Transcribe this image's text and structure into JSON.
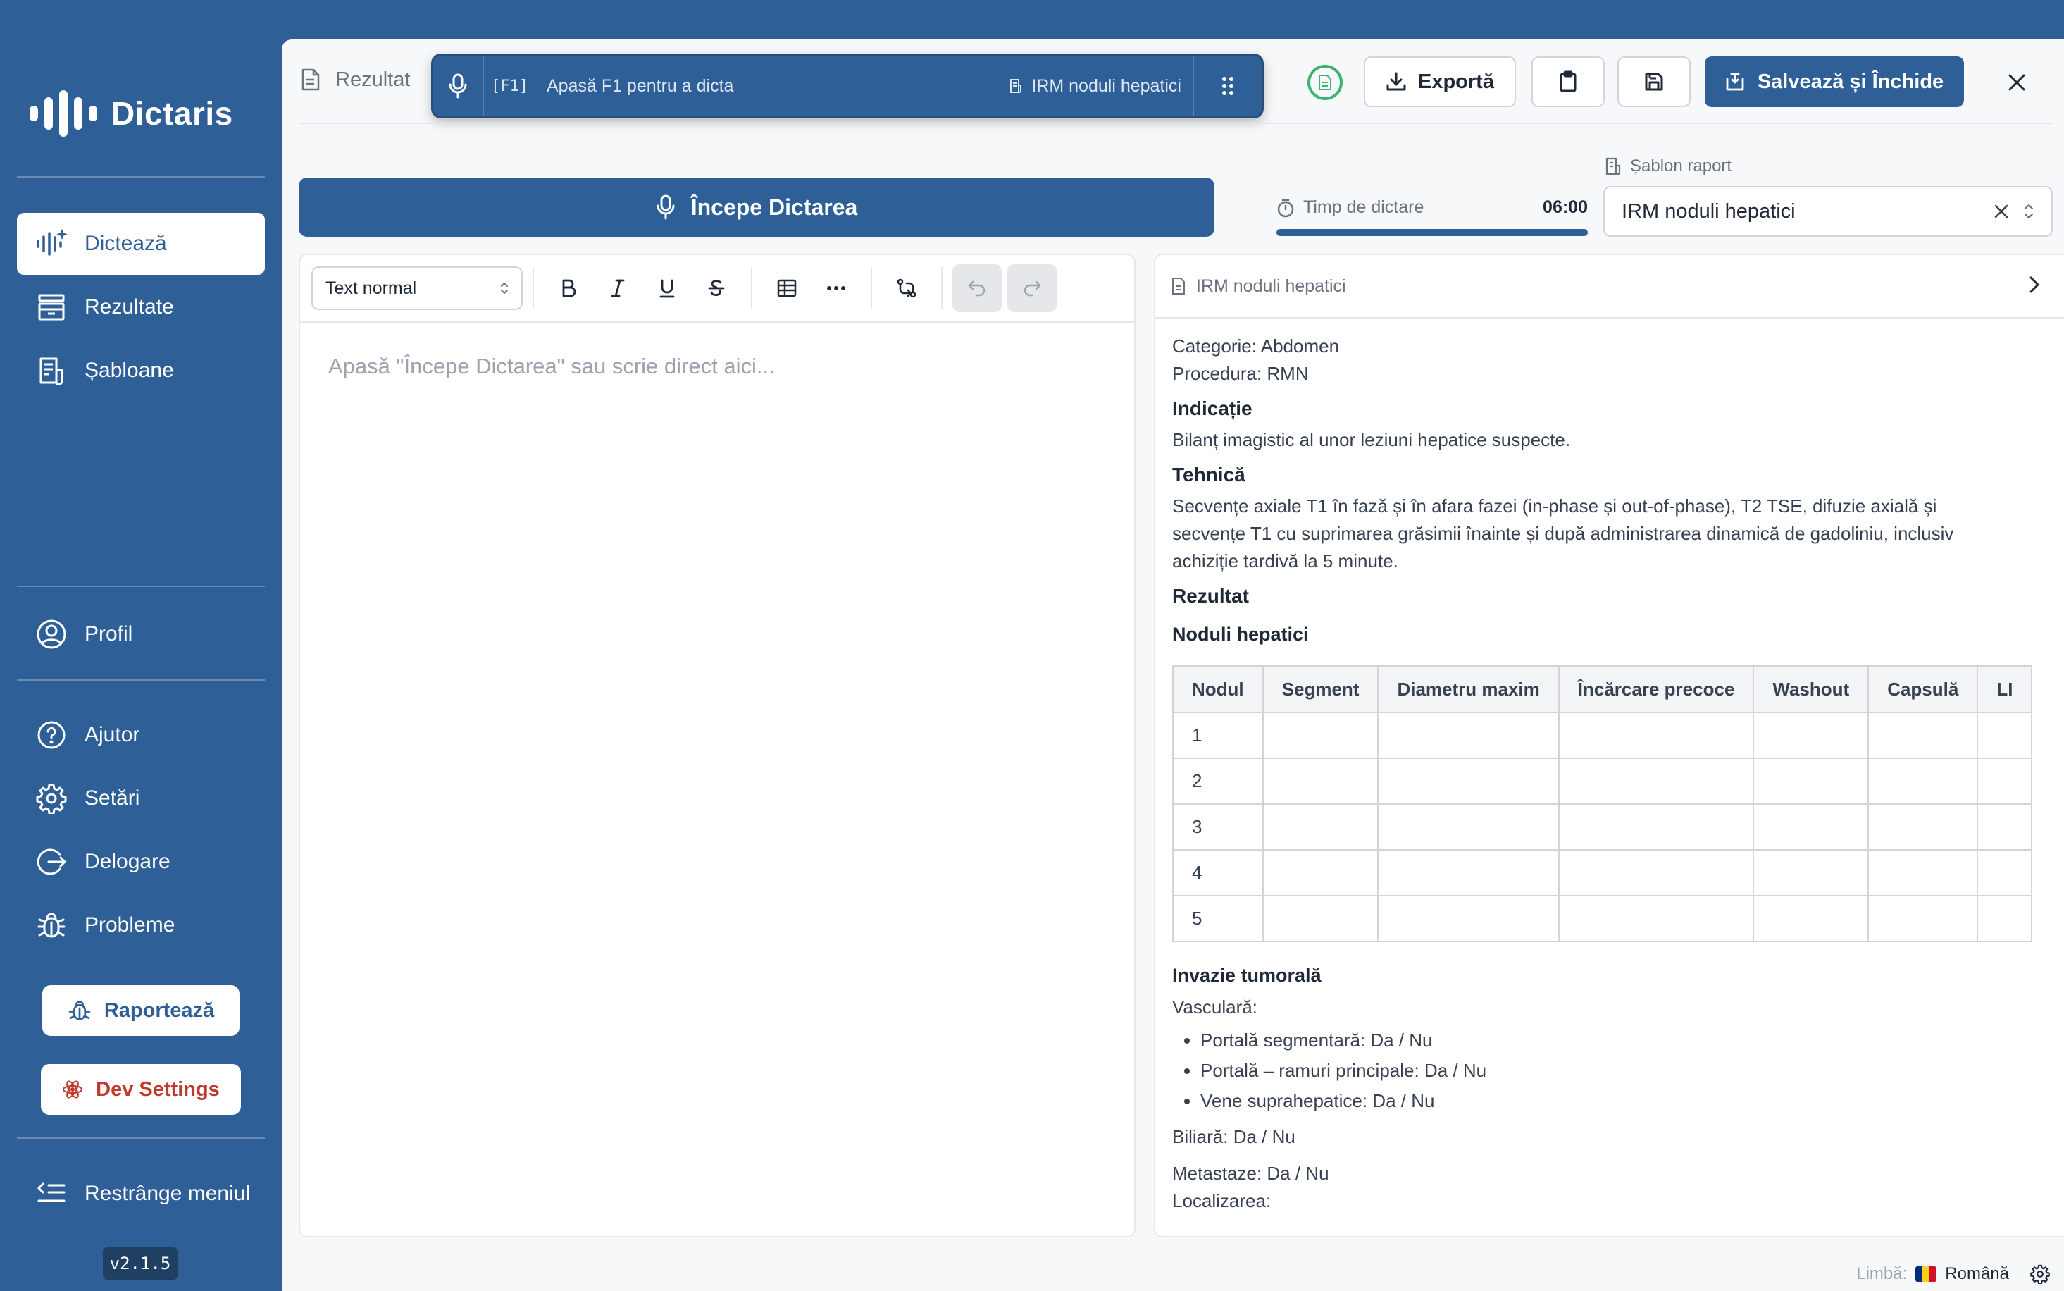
{
  "app": {
    "name": "Dictaris",
    "version": "v2.1.5"
  },
  "sidebar": {
    "nav": [
      {
        "label": "Dictează",
        "icon": "waveform-sparkle-icon",
        "active": true
      },
      {
        "label": "Rezultate",
        "icon": "archive-icon"
      },
      {
        "label": "Șabloane",
        "icon": "document-list-icon"
      }
    ],
    "profile": {
      "label": "Profil",
      "icon": "user-circle-icon"
    },
    "secondary": [
      {
        "label": "Ajutor",
        "icon": "help-circle-icon"
      },
      {
        "label": "Setări",
        "icon": "gear-icon"
      },
      {
        "label": "Delogare",
        "icon": "logout-icon"
      },
      {
        "label": "Probleme",
        "icon": "bug-icon"
      }
    ],
    "report_btn": "Raportează",
    "dev_btn": "Dev Settings",
    "collapse": "Restrânge meniul"
  },
  "toolbar": {
    "title": "Rezultat",
    "dictation_bar": {
      "shortcut": "[F1]",
      "hint": "Apasă F1 pentru a dicta",
      "template": "IRM noduli hepatici"
    },
    "export_label": "Exportă",
    "save_close_label": "Salvează și Închide"
  },
  "dictation": {
    "start_label": "Începe Dictarea",
    "timer_label": "Timp de dictare",
    "timer_value": "06:00",
    "timer_progress": 1.0
  },
  "template_select": {
    "label": "Șablon raport",
    "value": "IRM noduli hepatici"
  },
  "editor": {
    "style_value": "Text normal",
    "placeholder": "Apasă \"Începe Dictarea\" sau scrie direct aici..."
  },
  "preview": {
    "title": "IRM noduli hepatici",
    "category": "Categorie: Abdomen",
    "procedure": "Procedura: RMN",
    "indication_h": "Indicație",
    "indication": "Bilanț imagistic al unor leziuni hepatice suspecte.",
    "technique_h": "Tehnică",
    "technique": "Secvențe axiale T1 în fază și în afara fazei (in-phase și out-of-phase), T2 TSE, difuzie axială și secvențe T1 cu suprimarea grăsimii înainte și după administrarea dinamică de gadoliniu, inclusiv achiziție tardivă la 5 minute.",
    "result_h": "Rezultat",
    "nodules_h": "Noduli hepatici",
    "table": {
      "headers": [
        "Nodul",
        "Segment",
        "Diametru maxim",
        "Încărcare precoce",
        "Washout",
        "Capsulă",
        "LI"
      ],
      "rows": [
        "1",
        "2",
        "3",
        "4",
        "5"
      ]
    },
    "invasion_h": "Invazie tumorală",
    "vascular": "Vasculară:",
    "vascular_items": [
      "Portală segmentară: Da / Nu",
      "Portală – ramuri principale: Da / Nu",
      "Vene suprahepatice: Da / Nu"
    ],
    "biliary": "Biliară: Da / Nu",
    "metastases": "Metastaze: Da / Nu",
    "localization": "Localizarea:"
  },
  "footer": {
    "lang_label": "Limbă:",
    "lang_value": "Română"
  },
  "colors": {
    "primary": "#2e5f97",
    "danger": "#c0392b",
    "success": "#3cb371"
  }
}
